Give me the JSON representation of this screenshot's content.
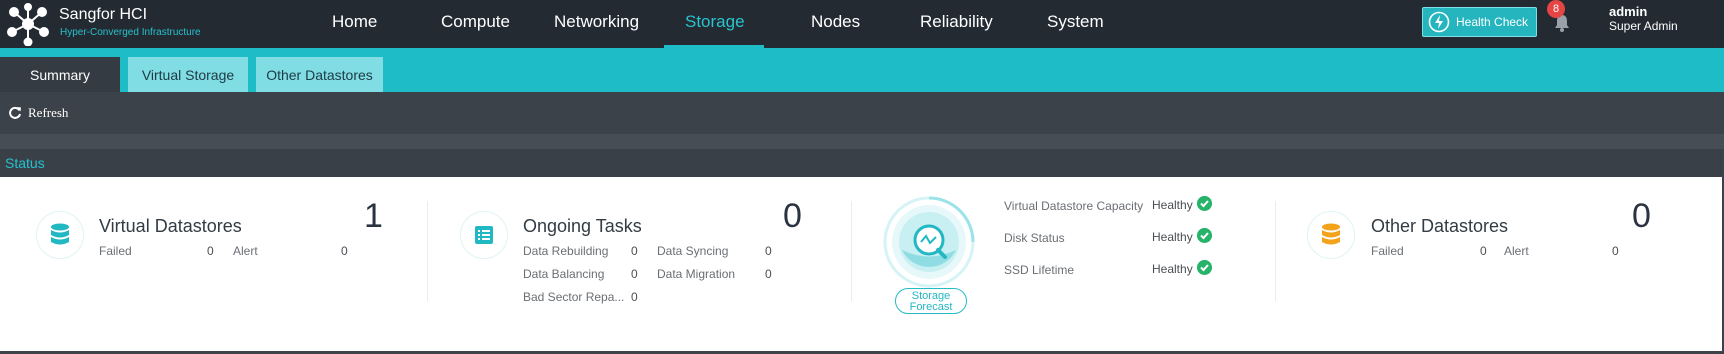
{
  "header": {
    "brand_title": "Sangfor HCI",
    "brand_subtitle": "Hyper-Converged Infrastructure",
    "nav": [
      "Home",
      "Compute",
      "Networking",
      "Storage",
      "Nodes",
      "Reliability",
      "System"
    ],
    "active_nav": "Storage",
    "health_check_label": "Health Check",
    "notification_count": "8",
    "user_name": "admin",
    "user_role": "Super Admin"
  },
  "subtabs": [
    "Summary",
    "Virtual Storage",
    "Other Datastores"
  ],
  "active_subtab": "Summary",
  "toolbar": {
    "refresh_label": "Refresh"
  },
  "status": {
    "section_title": "Status",
    "virtual_datastores": {
      "title": "Virtual Datastores",
      "failed_label": "Failed",
      "failed_value": "0",
      "alert_label": "Alert",
      "alert_value": "0",
      "total": "1"
    },
    "ongoing_tasks": {
      "title": "Ongoing Tasks",
      "rebuilding_label": "Data Rebuilding",
      "rebuilding_value": "0",
      "syncing_label": "Data Syncing",
      "syncing_value": "0",
      "balancing_label": "Data Balancing",
      "balancing_value": "0",
      "migration_label": "Data Migration",
      "migration_value": "0",
      "bad_sector_label": "Bad Sector Repa...",
      "bad_sector_value": "0",
      "total": "0"
    },
    "forecast": {
      "button_label": "Storage Forecast",
      "rows": [
        {
          "label": "Virtual Datastore Capacity",
          "value": "Healthy"
        },
        {
          "label": "Disk Status",
          "value": "Healthy"
        },
        {
          "label": "SSD Lifetime",
          "value": "Healthy"
        }
      ]
    },
    "other_datastores": {
      "title": "Other Datastores",
      "failed_label": "Failed",
      "failed_value": "0",
      "alert_label": "Alert",
      "alert_value": "0",
      "total": "0"
    }
  },
  "colors": {
    "accent": "#1ebcc6",
    "topbar": "#232a32",
    "healthy_check": "#27b36a",
    "badge": "#e54545",
    "other_datastore_icon": "#f2a31b"
  }
}
